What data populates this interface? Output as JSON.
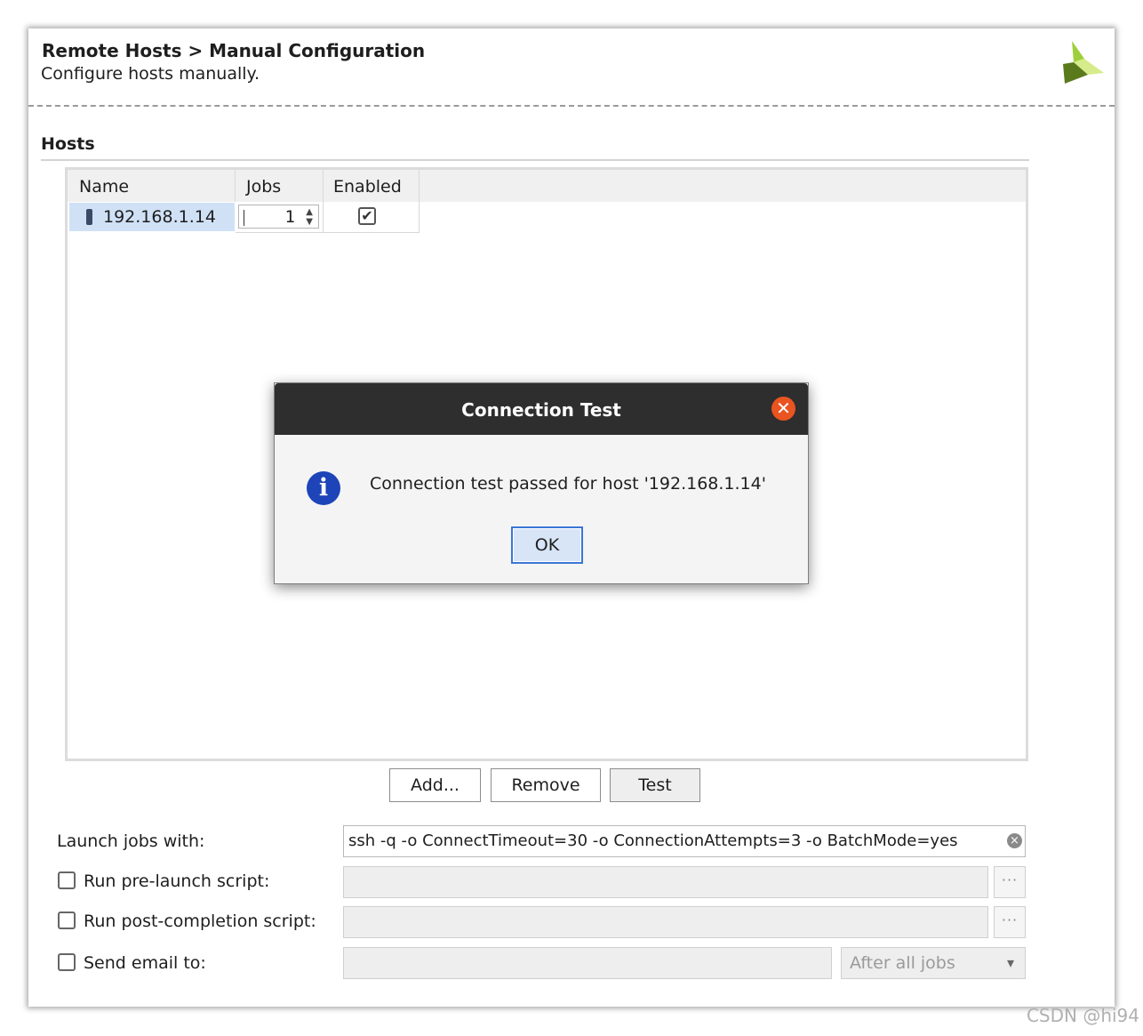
{
  "header": {
    "title": "Remote Hosts > Manual Configuration",
    "subtitle": "Configure hosts manually.",
    "logo_icon": "xilinx-logo-icon"
  },
  "hosts": {
    "section_title": "Hosts",
    "columns": [
      "Name",
      "Jobs",
      "Enabled"
    ],
    "rows": [
      {
        "name": "192.168.1.14",
        "jobs": "1",
        "enabled": true
      }
    ],
    "buttons": {
      "add": "Add...",
      "remove": "Remove",
      "test": "Test"
    }
  },
  "options": {
    "launch_label": "Launch jobs with:",
    "launch_value": "ssh -q -o ConnectTimeout=30 -o ConnectionAttempts=3 -o BatchMode=yes",
    "prelaunch_label": "Run pre-launch script:",
    "postcompletion_label": "Run post-completion script:",
    "email_label": "Send email to:",
    "email_when": "After all jobs",
    "browse_label": "···"
  },
  "dialog": {
    "title": "Connection Test",
    "message": "Connection test passed for host '192.168.1.14'",
    "ok_label": "OK",
    "close_glyph": "✕",
    "info_glyph": "i"
  },
  "watermark": "CSDN @hi94",
  "colors": {
    "selection": "#d0e1f6",
    "dialog_titlebar": "#2e2e2e",
    "close_button": "#e95420",
    "info_icon": "#1d44b8",
    "ok_border": "#3b76d6"
  }
}
